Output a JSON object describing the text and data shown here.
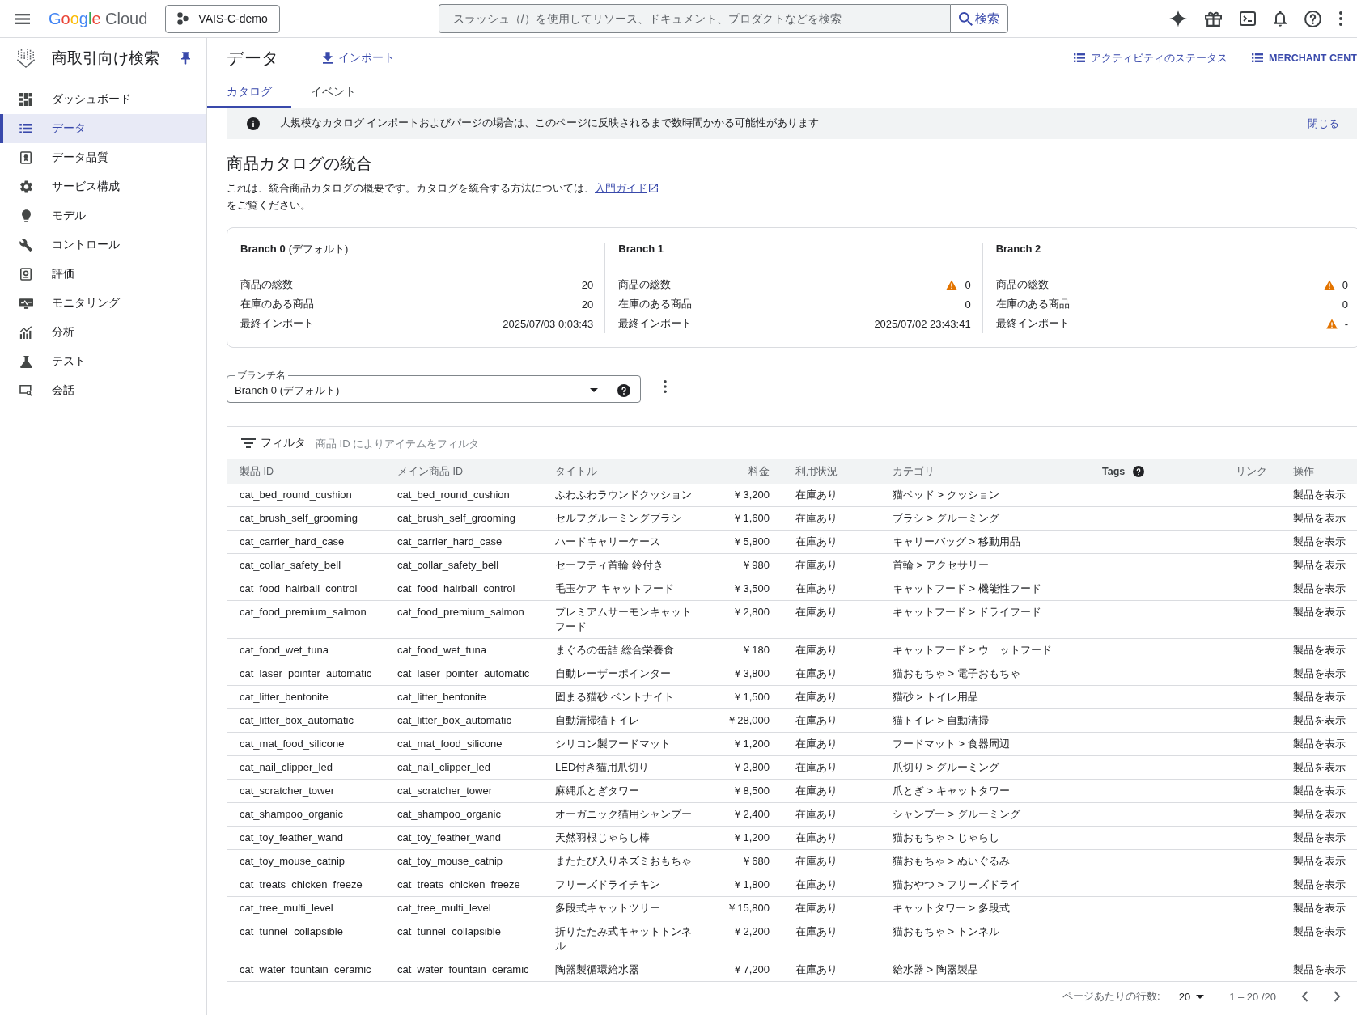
{
  "top_bar": {
    "logo": "Google Cloud",
    "project": "VAIS-C-demo",
    "search_placeholder": "スラッシュ（/）を使用してリソース、ドキュメント、プロダクトなどを検索",
    "search_button": "検索"
  },
  "sidebar": {
    "title": "商取引向け検索",
    "items": [
      {
        "label": "ダッシュボード",
        "selected": false
      },
      {
        "label": "データ",
        "selected": true
      },
      {
        "label": "データ品質",
        "selected": false
      },
      {
        "label": "サービス構成",
        "selected": false
      },
      {
        "label": "モデル",
        "selected": false
      },
      {
        "label": "コントロール",
        "selected": false
      },
      {
        "label": "評価",
        "selected": false
      },
      {
        "label": "モニタリング",
        "selected": false
      },
      {
        "label": "分析",
        "selected": false
      },
      {
        "label": "テスト",
        "selected": false
      },
      {
        "label": "会話",
        "selected": false
      }
    ]
  },
  "header": {
    "title": "データ",
    "import": "インポート",
    "links": [
      {
        "label": "アクティビティのステータス",
        "kind": "text"
      },
      {
        "label": "MERCHANT CENT",
        "kind": "button"
      }
    ]
  },
  "tabs": [
    {
      "label": "カタログ",
      "selected": true
    },
    {
      "label": "イベント",
      "selected": false
    }
  ],
  "banner": {
    "text": "大規模なカタログ インポートおよびパージの場合は、このページに反映されるまで数時間かかる可能性があります",
    "close": "閉じる"
  },
  "catalog": {
    "heading": "商品カタログの統合",
    "description": "これは、統合商品カタログの概要です。カタログを統合する方法については、",
    "guide_link": "入門ガイド",
    "description_end": "をご覧ください。"
  },
  "branches": [
    {
      "name": "Branch 0",
      "note": "(デフォルト)",
      "stats": [
        {
          "label": "商品の総数",
          "value": "20",
          "warning": false
        },
        {
          "label": "在庫のある商品",
          "value": "20",
          "warning": false
        },
        {
          "label": "最終インポート",
          "value": "2025/07/03 0:03:43",
          "warning": false
        }
      ]
    },
    {
      "name": "Branch 1",
      "stats": [
        {
          "label": "商品の総数",
          "value": "0",
          "warning": true
        },
        {
          "label": "在庫のある商品",
          "value": "0",
          "warning": false
        },
        {
          "label": "最終インポート",
          "value": "2025/07/02 23:43:41",
          "warning": false
        }
      ]
    },
    {
      "name": "Branch 2",
      "stats": [
        {
          "label": "商品の総数",
          "value": "0",
          "warning": true
        },
        {
          "label": "在庫のある商品",
          "value": "0",
          "warning": false
        },
        {
          "label": "最終インポート",
          "value": "-",
          "warning": true
        }
      ]
    }
  ],
  "branch_select": {
    "label": "ブランチ名",
    "value": "Branch 0 (デフォルト)"
  },
  "filter": {
    "label": "フィルタ",
    "placeholder": "商品 ID によりアイテムをフィルタ"
  },
  "table": {
    "columns": [
      {
        "label": "製品 ID",
        "help": false
      },
      {
        "label": "メイン商品 ID",
        "help": false
      },
      {
        "label": "タイトル",
        "help": false
      },
      {
        "label": "料金",
        "help": false
      },
      {
        "label": "利用状況",
        "help": false
      },
      {
        "label": "カテゴリ",
        "help": false
      },
      {
        "label": "Tags",
        "help": true
      },
      {
        "label": "リンク",
        "help": false
      },
      {
        "label": "操作",
        "help": false
      }
    ],
    "rows": [
      {
        "product_id": "cat_bed_round_cushion",
        "main_product_id": "cat_bed_round_cushion",
        "title": "ふわふわラウンドクッション",
        "price": "￥3,200",
        "availability": "在庫あり",
        "category": "猫ベッド > クッション",
        "action": "製品を表示"
      },
      {
        "product_id": "cat_brush_self_grooming",
        "main_product_id": "cat_brush_self_grooming",
        "title": "セルフグルーミングブラシ",
        "price": "￥1,600",
        "availability": "在庫あり",
        "category": "ブラシ > グルーミング",
        "action": "製品を表示"
      },
      {
        "product_id": "cat_carrier_hard_case",
        "main_product_id": "cat_carrier_hard_case",
        "title": "ハードキャリーケース",
        "price": "￥5,800",
        "availability": "在庫あり",
        "category": "キャリーバッグ > 移動用品",
        "action": "製品を表示"
      },
      {
        "product_id": "cat_collar_safety_bell",
        "main_product_id": "cat_collar_safety_bell",
        "title": "セーフティ首輪 鈴付き",
        "price": "￥980",
        "availability": "在庫あり",
        "category": "首輪 > アクセサリー",
        "action": "製品を表示"
      },
      {
        "product_id": "cat_food_hairball_control",
        "main_product_id": "cat_food_hairball_control",
        "title": "毛玉ケア キャットフード",
        "price": "￥3,500",
        "availability": "在庫あり",
        "category": "キャットフード > 機能性フード",
        "action": "製品を表示"
      },
      {
        "product_id": "cat_food_premium_salmon",
        "main_product_id": "cat_food_premium_salmon",
        "title": "プレミアムサーモンキャットフード",
        "price": "￥2,800",
        "availability": "在庫あり",
        "category": "キャットフード > ドライフード",
        "action": "製品を表示"
      },
      {
        "product_id": "cat_food_wet_tuna",
        "main_product_id": "cat_food_wet_tuna",
        "title": "まぐろの缶詰 総合栄養食",
        "price": "￥180",
        "availability": "在庫あり",
        "category": "キャットフード > ウェットフード",
        "action": "製品を表示"
      },
      {
        "product_id": "cat_laser_pointer_automatic",
        "main_product_id": "cat_laser_pointer_automatic",
        "title": "自動レーザーポインター",
        "price": "￥3,800",
        "availability": "在庫あり",
        "category": "猫おもちゃ > 電子おもちゃ",
        "action": "製品を表示"
      },
      {
        "product_id": "cat_litter_bentonite",
        "main_product_id": "cat_litter_bentonite",
        "title": "固まる猫砂 ベントナイト",
        "price": "￥1,500",
        "availability": "在庫あり",
        "category": "猫砂 > トイレ用品",
        "action": "製品を表示"
      },
      {
        "product_id": "cat_litter_box_automatic",
        "main_product_id": "cat_litter_box_automatic",
        "title": "自動清掃猫トイレ",
        "price": "￥28,000",
        "availability": "在庫あり",
        "category": "猫トイレ > 自動清掃",
        "action": "製品を表示"
      },
      {
        "product_id": "cat_mat_food_silicone",
        "main_product_id": "cat_mat_food_silicone",
        "title": "シリコン製フードマット",
        "price": "￥1,200",
        "availability": "在庫あり",
        "category": "フードマット > 食器周辺",
        "action": "製品を表示"
      },
      {
        "product_id": "cat_nail_clipper_led",
        "main_product_id": "cat_nail_clipper_led",
        "title": "LED付き猫用爪切り",
        "price": "￥2,800",
        "availability": "在庫あり",
        "category": "爪切り > グルーミング",
        "action": "製品を表示"
      },
      {
        "product_id": "cat_scratcher_tower",
        "main_product_id": "cat_scratcher_tower",
        "title": "麻縄爪とぎタワー",
        "price": "￥8,500",
        "availability": "在庫あり",
        "category": "爪とぎ > キャットタワー",
        "action": "製品を表示"
      },
      {
        "product_id": "cat_shampoo_organic",
        "main_product_id": "cat_shampoo_organic",
        "title": "オーガニック猫用シャンプー",
        "price": "￥2,400",
        "availability": "在庫あり",
        "category": "シャンプー > グルーミング",
        "action": "製品を表示"
      },
      {
        "product_id": "cat_toy_feather_wand",
        "main_product_id": "cat_toy_feather_wand",
        "title": "天然羽根じゃらし棒",
        "price": "￥1,200",
        "availability": "在庫あり",
        "category": "猫おもちゃ > じゃらし",
        "action": "製品を表示"
      },
      {
        "product_id": "cat_toy_mouse_catnip",
        "main_product_id": "cat_toy_mouse_catnip",
        "title": "またたび入りネズミおもちゃ",
        "price": "￥680",
        "availability": "在庫あり",
        "category": "猫おもちゃ > ぬいぐるみ",
        "action": "製品を表示"
      },
      {
        "product_id": "cat_treats_chicken_freeze",
        "main_product_id": "cat_treats_chicken_freeze",
        "title": "フリーズドライチキン",
        "price": "￥1,800",
        "availability": "在庫あり",
        "category": "猫おやつ > フリーズドライ",
        "action": "製品を表示"
      },
      {
        "product_id": "cat_tree_multi_level",
        "main_product_id": "cat_tree_multi_level",
        "title": "多段式キャットツリー",
        "price": "￥15,800",
        "availability": "在庫あり",
        "category": "キャットタワー > 多段式",
        "action": "製品を表示"
      },
      {
        "product_id": "cat_tunnel_collapsible",
        "main_product_id": "cat_tunnel_collapsible",
        "title": "折りたたみ式キャットトンネル",
        "price": "￥2,200",
        "availability": "在庫あり",
        "category": "猫おもちゃ > トンネル",
        "action": "製品を表示"
      },
      {
        "product_id": "cat_water_fountain_ceramic",
        "main_product_id": "cat_water_fountain_ceramic",
        "title": "陶器製循環給水器",
        "price": "￥7,200",
        "availability": "在庫あり",
        "category": "給水器 > 陶器製品",
        "action": "製品を表示"
      }
    ]
  },
  "pagination": {
    "rows_label": "ページあたりの行数:",
    "rows_per_page": "20",
    "range": "1 – 20 /20"
  }
}
